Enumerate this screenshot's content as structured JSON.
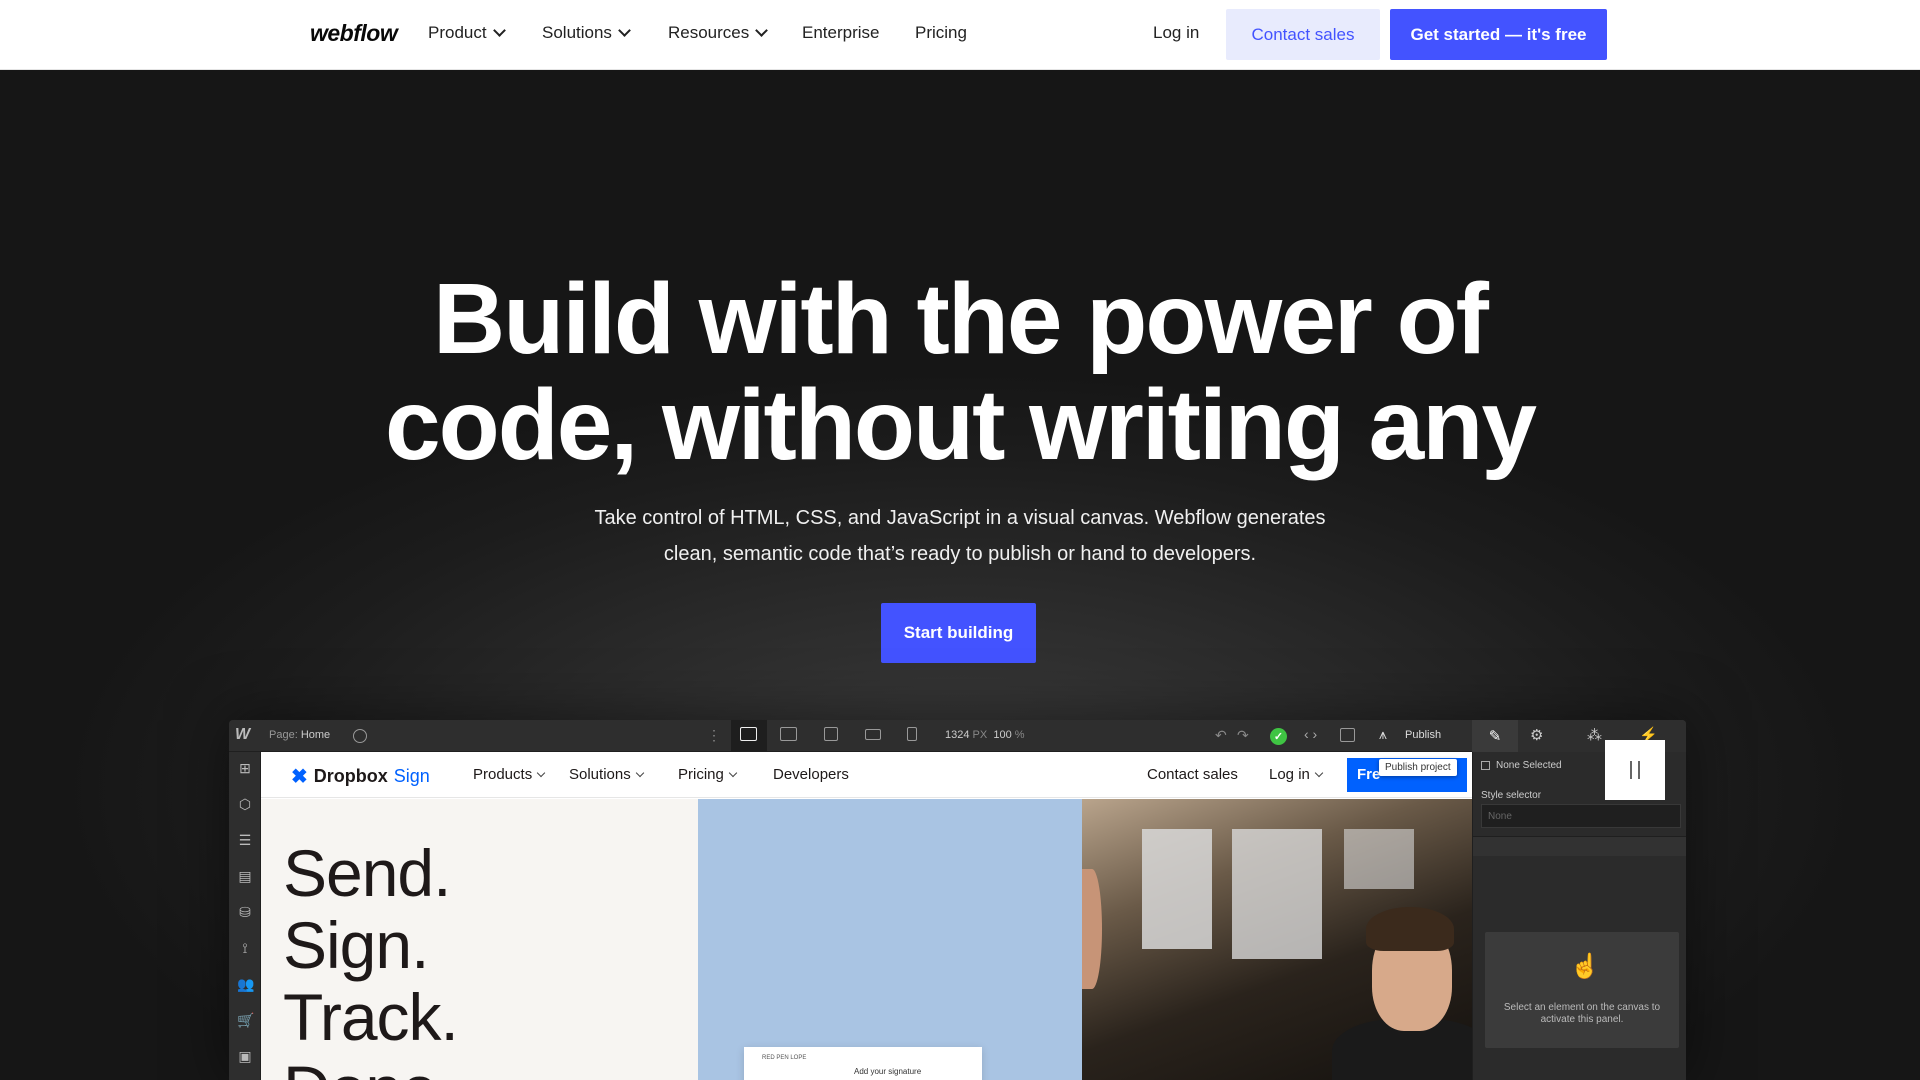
{
  "nav": {
    "logo": "webflow",
    "items": [
      {
        "label": "Product",
        "dropdown": true
      },
      {
        "label": "Solutions",
        "dropdown": true
      },
      {
        "label": "Resources",
        "dropdown": true
      },
      {
        "label": "Enterprise",
        "dropdown": false
      },
      {
        "label": "Pricing",
        "dropdown": false
      }
    ],
    "login": "Log in",
    "contact_sales": "Contact sales",
    "get_started": "Get started — it's free"
  },
  "hero": {
    "title_line1": "Build with the power of",
    "title_line2": "code, without writing any",
    "subtitle_line1": "Take control of HTML, CSS, and JavaScript in a visual canvas. Webflow generates",
    "subtitle_line2": "clean, semantic code that’s ready to publish or hand to developers.",
    "cta": "Start building"
  },
  "editor": {
    "logo": "W",
    "page_label": "Page:",
    "page_name": "Home",
    "canvas_width": "1324",
    "canvas_unit": "PX",
    "zoom": "100",
    "zoom_unit": "%",
    "publish": "Publish",
    "publish_tooltip": "Publish project",
    "none_selected": "None Selected",
    "style_selector": "Style selector",
    "style_input_placeholder": "None",
    "select_hint": "Select an element on the canvas to activate this panel.",
    "colors": {
      "accent": "#4353ff",
      "status_ok": "#3fc443"
    }
  },
  "site": {
    "brand": "Dropbox",
    "brand_suffix": "Sign",
    "nav": [
      {
        "label": "Products",
        "dropdown": true
      },
      {
        "label": "Solutions",
        "dropdown": true
      },
      {
        "label": "Pricing",
        "dropdown": true
      },
      {
        "label": "Developers",
        "dropdown": false
      }
    ],
    "contact_sales": "Contact sales",
    "login": "Log in",
    "free_button": "Fre",
    "hero_lines": [
      "Send.",
      "Sign.",
      "Track.",
      "Done."
    ],
    "card_small": "RED PEN LOPE",
    "card_text": "Add your signature"
  }
}
